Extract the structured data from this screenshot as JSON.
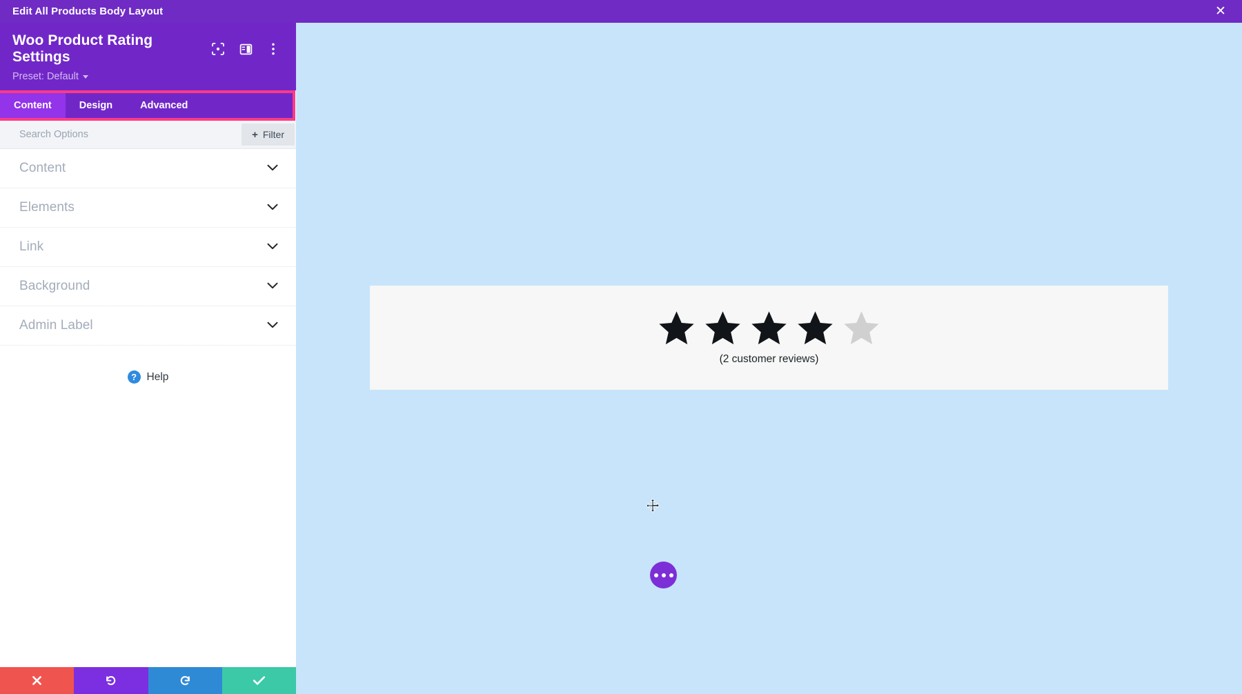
{
  "window": {
    "title": "Edit All Products Body Layout",
    "close_icon": "close-icon"
  },
  "panel": {
    "title": "Woo Product Rating Settings",
    "preset_label": "Preset: Default",
    "header_icons": [
      {
        "name": "focus-target-icon"
      },
      {
        "name": "panel-layout-icon"
      },
      {
        "name": "more-vertical-icon"
      }
    ],
    "tabs": [
      {
        "label": "Content",
        "active": true
      },
      {
        "label": "Design",
        "active": false
      },
      {
        "label": "Advanced",
        "active": false
      }
    ],
    "search": {
      "placeholder": "Search Options",
      "value": ""
    },
    "filter": {
      "label": "Filter",
      "plus": "+"
    },
    "sections": [
      {
        "label": "Content"
      },
      {
        "label": "Elements"
      },
      {
        "label": "Link"
      },
      {
        "label": "Background"
      },
      {
        "label": "Admin Label"
      }
    ],
    "help": {
      "label": "Help",
      "icon_glyph": "?"
    },
    "actions": [
      {
        "name": "cancel-button",
        "icon": "close-icon"
      },
      {
        "name": "undo-button",
        "icon": "undo-icon"
      },
      {
        "name": "redo-button",
        "icon": "redo-icon"
      },
      {
        "name": "save-button",
        "icon": "check-icon"
      }
    ]
  },
  "preview": {
    "rating": {
      "filled_stars": 4,
      "total_stars": 5,
      "reviews_text": "(2 customer reviews)"
    },
    "fab": {
      "name": "more-options-fab",
      "dots": 3
    },
    "cursor": {
      "name": "move-cursor"
    }
  },
  "colors": {
    "topbar_purple": "#6f2bc4",
    "panel_purple": "#7127c8",
    "tab_active_purple": "#9333ea",
    "highlight_pink": "#ff3a85",
    "canvas_blue": "#c7e4fb",
    "card_white": "#f6f7f6",
    "star_filled": "#111418",
    "star_empty": "#d0d0d0",
    "cancel_red": "#f0544f",
    "undo_purple": "#7c2fe0",
    "redo_blue": "#2f8ad6",
    "save_teal": "#3cc9a7",
    "help_blue": "#2f8ae0"
  }
}
